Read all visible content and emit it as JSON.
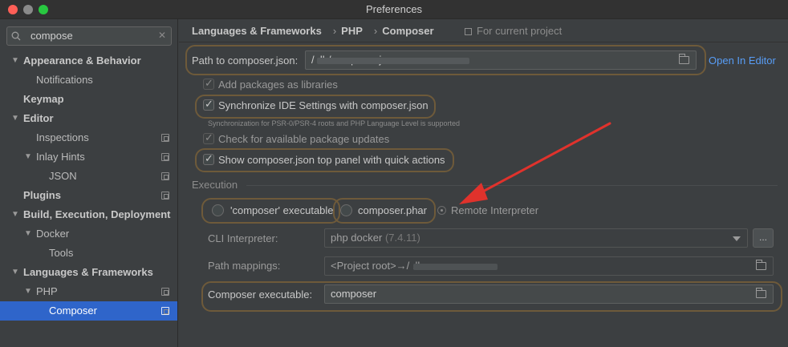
{
  "window": {
    "title": "Preferences"
  },
  "search": {
    "query": "compose"
  },
  "sidebar": {
    "items": [
      {
        "label": "Appearance & Behavior"
      },
      {
        "label": "Notifications"
      },
      {
        "label": "Keymap"
      },
      {
        "label": "Editor"
      },
      {
        "label": "Inspections"
      },
      {
        "label": "Inlay Hints"
      },
      {
        "label": "JSON"
      },
      {
        "label": "Plugins"
      },
      {
        "label": "Build, Execution, Deployment"
      },
      {
        "label": "Docker"
      },
      {
        "label": "Tools"
      },
      {
        "label": "Languages & Frameworks"
      },
      {
        "label": "PHP"
      },
      {
        "label": "Composer"
      }
    ]
  },
  "breadcrumb": {
    "part1": "Languages & Frameworks",
    "part2": "PHP",
    "part3": "Composer",
    "sep": "›",
    "scope": "For current project"
  },
  "composer_json": {
    "label": "Path to composer.json:",
    "value": "/                                            .lh/composer.json",
    "open_link": "Open In Editor"
  },
  "options": {
    "add_packages": "Add packages as libraries",
    "sync_ide": "Synchronize IDE Settings with composer.json",
    "sync_note": "Synchronization for PSR-0/PSR-4 roots and PHP Language Level is supported",
    "check_updates": "Check for available package updates",
    "show_panel": "Show composer.json top panel with quick actions"
  },
  "execution": {
    "title": "Execution",
    "radio_executable": "'composer' executable",
    "radio_phar": "composer.phar",
    "radio_remote": "Remote Interpreter",
    "cli_label": "CLI Interpreter:",
    "cli_value": "php docker",
    "cli_version": "(7.4.11)",
    "dots": "...",
    "path_label": "Path mappings:",
    "path_value": "<Project root>→/                        .lh",
    "exec_label": "Composer executable:",
    "exec_value": "composer"
  },
  "colors": {
    "accent": "#2f65ca",
    "link": "#589df6",
    "highlight": "#6e5a3a",
    "annotation_arrow": "#e0322c"
  }
}
